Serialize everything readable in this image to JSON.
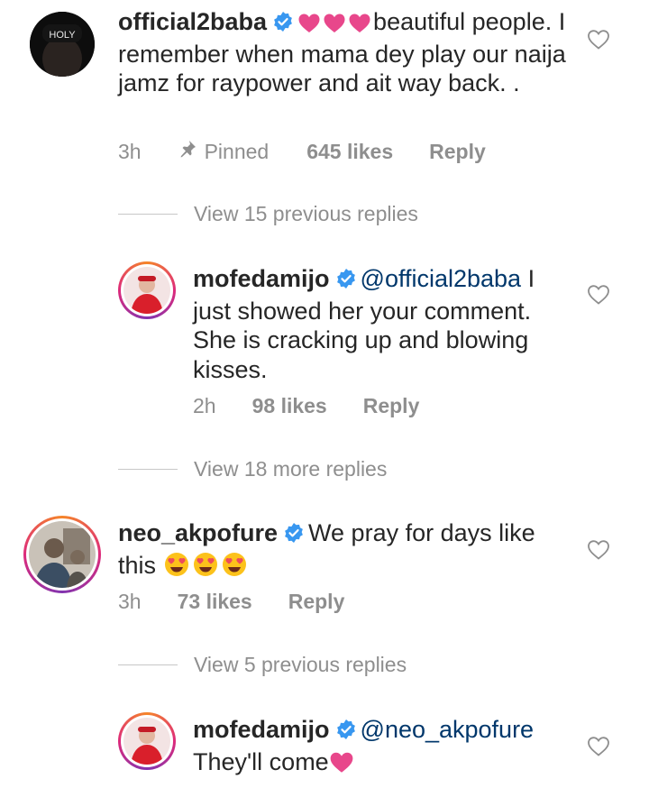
{
  "comments": [
    {
      "username": "official2baba",
      "text": "beautiful people.  I remember when mama dey play our naija jamz for raypower and ait way back. .",
      "time": "3h",
      "pinned": "Pinned",
      "likes": "645 likes",
      "reply": "Reply",
      "avatar_text": "HOLY"
    },
    {
      "username": "mofedamijo",
      "mention": "@official2baba",
      "text": " I just showed her your comment. She is cracking up and blowing kisses.",
      "time": "2h",
      "likes": "98 likes",
      "reply": "Reply"
    },
    {
      "username": "neo_akpofure",
      "text": "We pray for days like this",
      "time": "3h",
      "likes": "73 likes",
      "reply": "Reply"
    },
    {
      "username": "mofedamijo",
      "mention": "@neo_akpofure",
      "text": "They'll come"
    }
  ],
  "view_replies": [
    "View 15 previous replies",
    "View 18 more replies",
    "View 5 previous replies"
  ],
  "colors": {
    "text": "#262626",
    "secondary": "#8e8e8e",
    "mention": "#00376b",
    "verified": "#3897f0",
    "heart": "#e8478b"
  },
  "icons": [
    "verified-badge-icon",
    "heart-emoji-icon",
    "pin-icon",
    "like-heart-outline-icon",
    "heart-eyes-emoji-icon"
  ]
}
